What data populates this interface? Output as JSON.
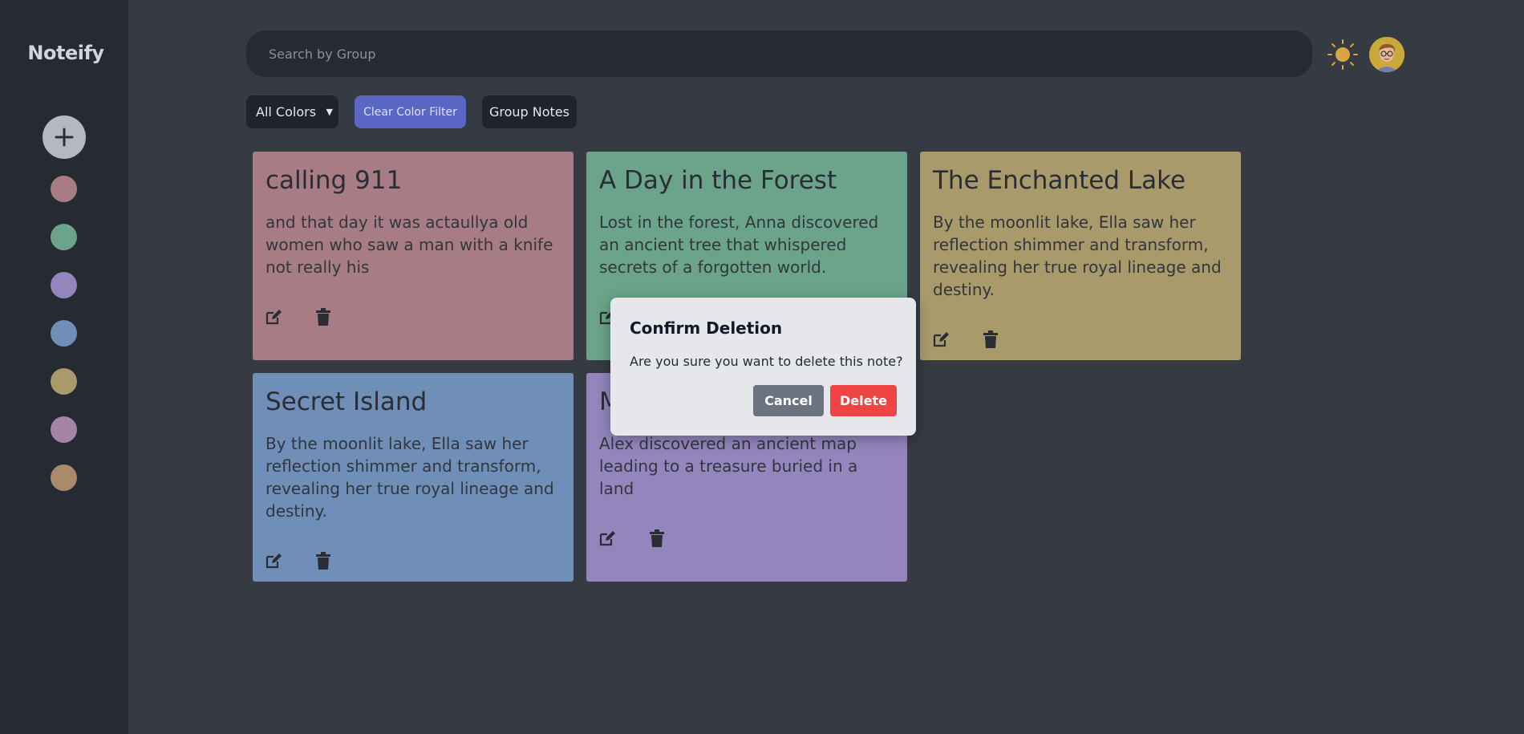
{
  "app": {
    "name": "Noteify"
  },
  "sidebar": {
    "color_dots": [
      {
        "name": "rose",
        "color": "#a77c84"
      },
      {
        "name": "green",
        "color": "#6ba48a"
      },
      {
        "name": "purple",
        "color": "#9486bd"
      },
      {
        "name": "blue",
        "color": "#6f8fb8"
      },
      {
        "name": "yellow",
        "color": "#a89a6a"
      },
      {
        "name": "pink",
        "color": "#a384a4"
      },
      {
        "name": "orange",
        "color": "#a98b6c"
      }
    ]
  },
  "search": {
    "placeholder": "Search by Group",
    "value": ""
  },
  "toolbar": {
    "color_select": "All Colors",
    "clear_label": "Clear Color Filter",
    "group_label": "Group Notes"
  },
  "notes": [
    {
      "title": "calling 911",
      "body": "and that day it was actaullya old women who saw a man with a knife not really his",
      "color": "#a77c84"
    },
    {
      "title": "A Day in the Forest",
      "body": "Lost in the forest, Anna discovered an ancient tree that whispered secrets of a forgotten world.",
      "color": "#6ba48a"
    },
    {
      "title": "The Enchanted Lake",
      "body": "By the moonlit lake, Ella saw her reflection shimmer and transform, revealing her true royal lineage and destiny.",
      "color": "#a89a6a"
    },
    {
      "title": "Secret Island",
      "body": "By the moonlit lake, Ella saw her reflection shimmer and transform, revealing her true royal lineage and destiny.",
      "color": "#6f8fb8"
    },
    {
      "title": "M",
      "body": "Alex discovered an ancient map leading to a treasure buried in a land",
      "color": "#9486bd"
    }
  ],
  "modal": {
    "title": "Confirm Deletion",
    "message": "Are you sure you want to delete this note?",
    "cancel_label": "Cancel",
    "delete_label": "Delete"
  },
  "colors": {
    "background": "#363a43",
    "sidebar": "#262a33",
    "accent": "#5a67c4",
    "danger": "#ef4444"
  }
}
